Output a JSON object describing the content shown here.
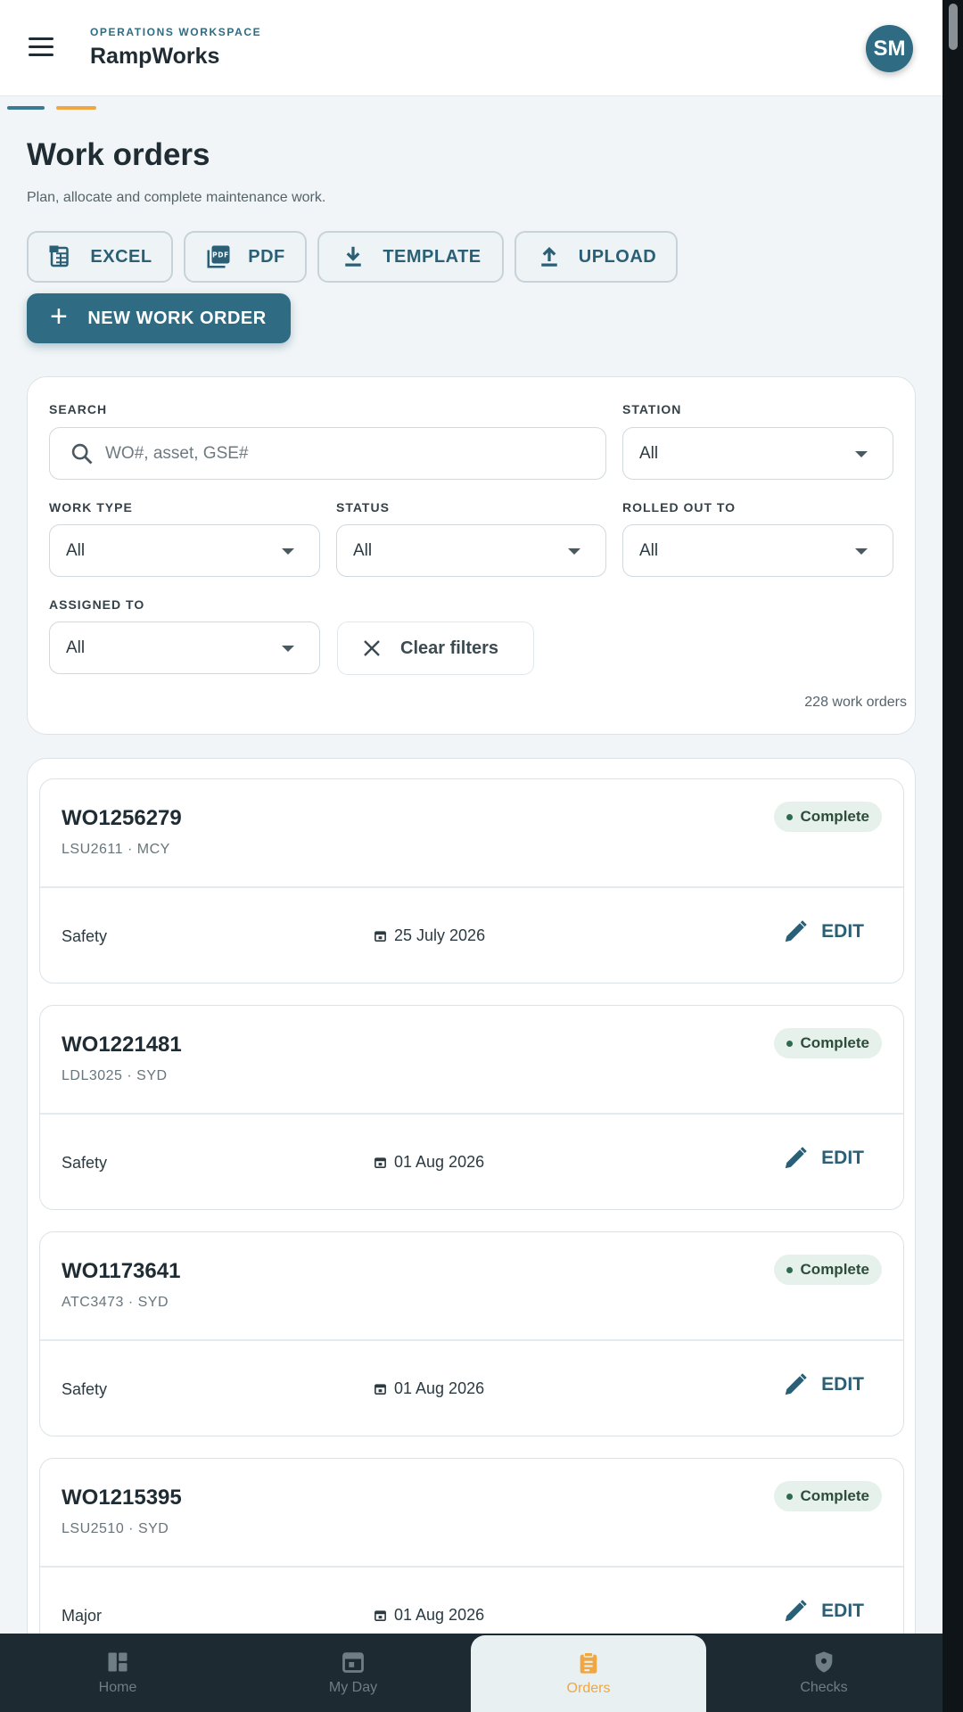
{
  "header": {
    "workspace_label": "OPERATIONS WORKSPACE",
    "app_name": "RampWorks",
    "avatar_initials": "SM"
  },
  "page": {
    "title": "Work orders",
    "subtitle": "Plan, allocate and complete maintenance work."
  },
  "toolbar": {
    "excel_label": "EXCEL",
    "pdf_label": "PDF",
    "template_label": "TEMPLATE",
    "upload_label": "UPLOAD",
    "new_label": "NEW WORK ORDER"
  },
  "filters": {
    "search_label": "SEARCH",
    "search_placeholder": "WO#, asset, GSE#",
    "station_label": "STATION",
    "station_value": "All",
    "work_type_label": "WORK TYPE",
    "work_type_value": "All",
    "status_label": "STATUS",
    "status_value": "All",
    "rolled_out_label": "ROLLED OUT TO",
    "rolled_out_value": "All",
    "assigned_label": "ASSIGNED TO",
    "assigned_value": "All",
    "clear_label": "Clear filters",
    "count_text": "228 work orders"
  },
  "work_orders": [
    {
      "id": "WO1256279",
      "sub": "LSU2611 · MCY",
      "status": "Complete",
      "type": "Safety",
      "date": "25 July 2026",
      "action": "EDIT"
    },
    {
      "id": "WO1221481",
      "sub": "LDL3025 · SYD",
      "status": "Complete",
      "type": "Safety",
      "date": "01 Aug 2026",
      "action": "EDIT"
    },
    {
      "id": "WO1173641",
      "sub": "ATC3473 · SYD",
      "status": "Complete",
      "type": "Safety",
      "date": "01 Aug 2026",
      "action": "EDIT"
    },
    {
      "id": "WO1215395",
      "sub": "LSU2510 · SYD",
      "status": "Complete",
      "type": "Major",
      "date": "01 Aug 2026",
      "action": "EDIT"
    }
  ],
  "nav": [
    {
      "label": "Home",
      "icon": "dashboard-icon"
    },
    {
      "label": "My Day",
      "icon": "calendar-icon"
    },
    {
      "label": "Orders",
      "icon": "clipboard-icon",
      "active": true
    },
    {
      "label": "Checks",
      "icon": "shield-icon"
    }
  ],
  "colors": {
    "primary": "#2f6b82",
    "accent": "#f0a742",
    "status_complete_bg": "#e5f1ea",
    "nav_bg": "#1d2a31"
  }
}
